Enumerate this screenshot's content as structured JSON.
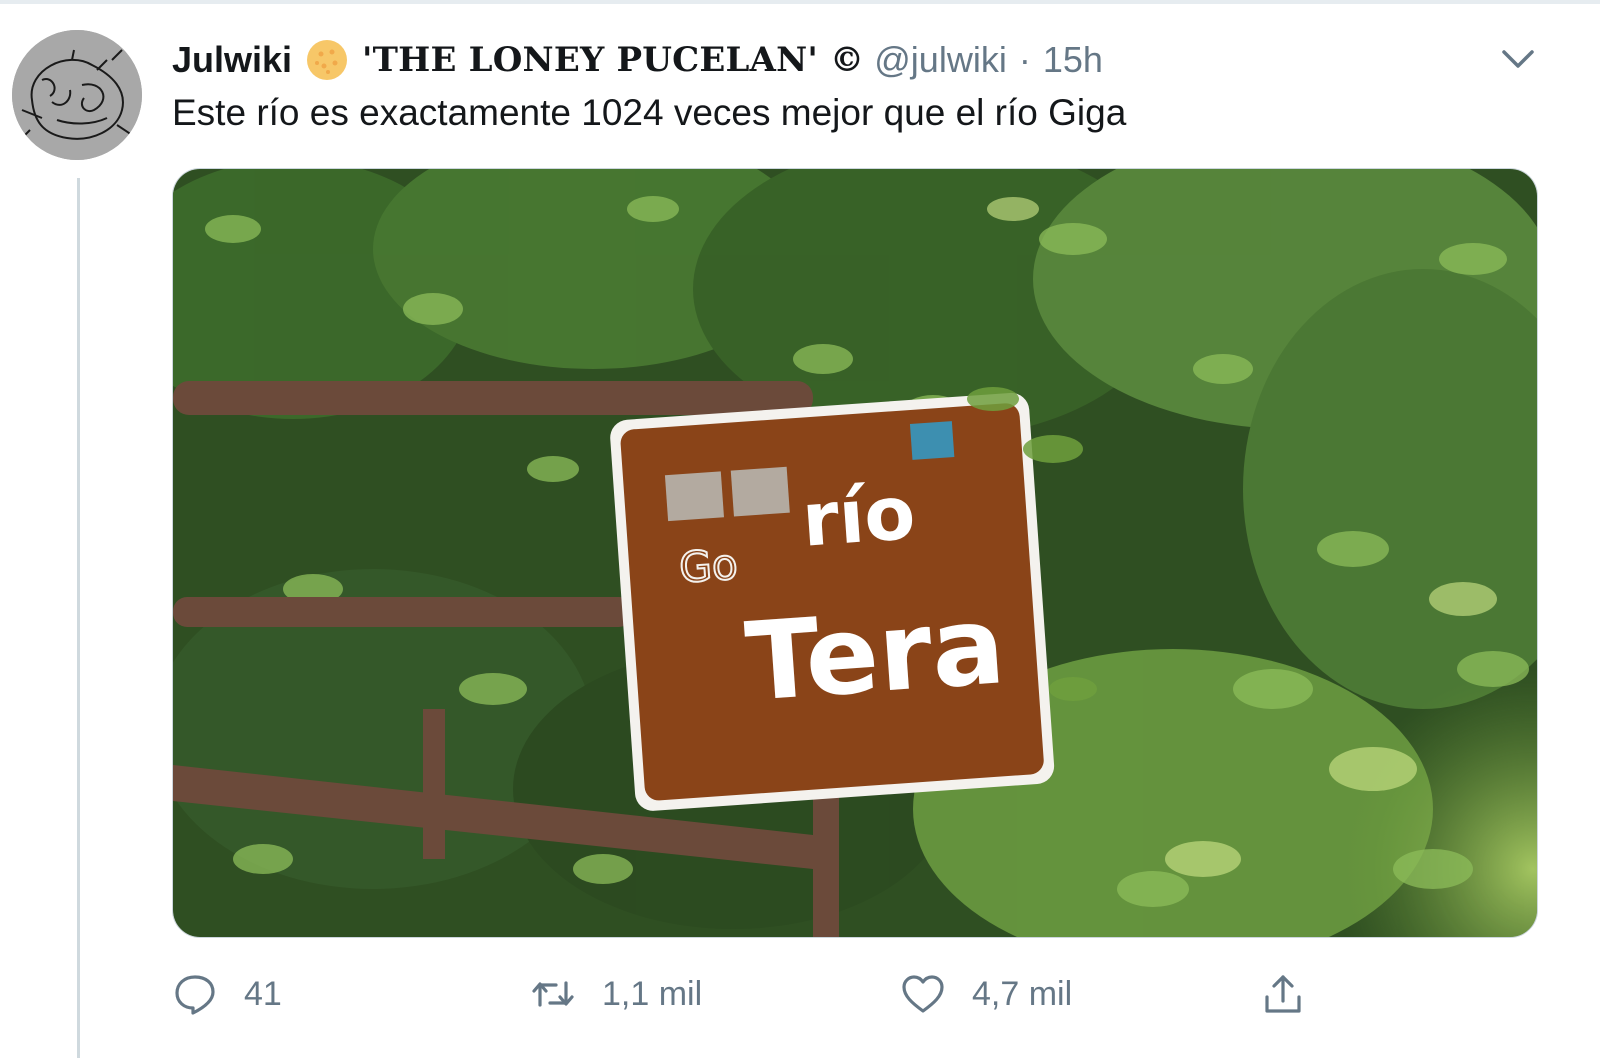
{
  "tweet": {
    "display_name": "Julwiki",
    "display_name_extra": "'THE LONEY PUCELAN' ©",
    "handle": "@julwiki",
    "separator": "·",
    "time": "15h",
    "text": "Este río es exactamente 1024 veces mejor que el río Giga"
  },
  "media": {
    "sign_line1": "río",
    "sign_line2": "Tera",
    "sign_graffiti": "Go",
    "colors": {
      "sign_brown": "#8a4418",
      "foliage": "#3f6b2a",
      "rail": "#6b4a3a"
    }
  },
  "actions": {
    "reply_count": "41",
    "retweet_count": "1,1 mil",
    "like_count": "4,7 mil"
  },
  "icons": {
    "emoji": "orange-circle-emoji",
    "caret": "chevron-down-icon",
    "reply": "reply-icon",
    "retweet": "retweet-icon",
    "like": "heart-icon",
    "share": "share-icon"
  },
  "colors": {
    "text": "#14171a",
    "secondary": "#657786",
    "border": "#ccd6dd"
  }
}
